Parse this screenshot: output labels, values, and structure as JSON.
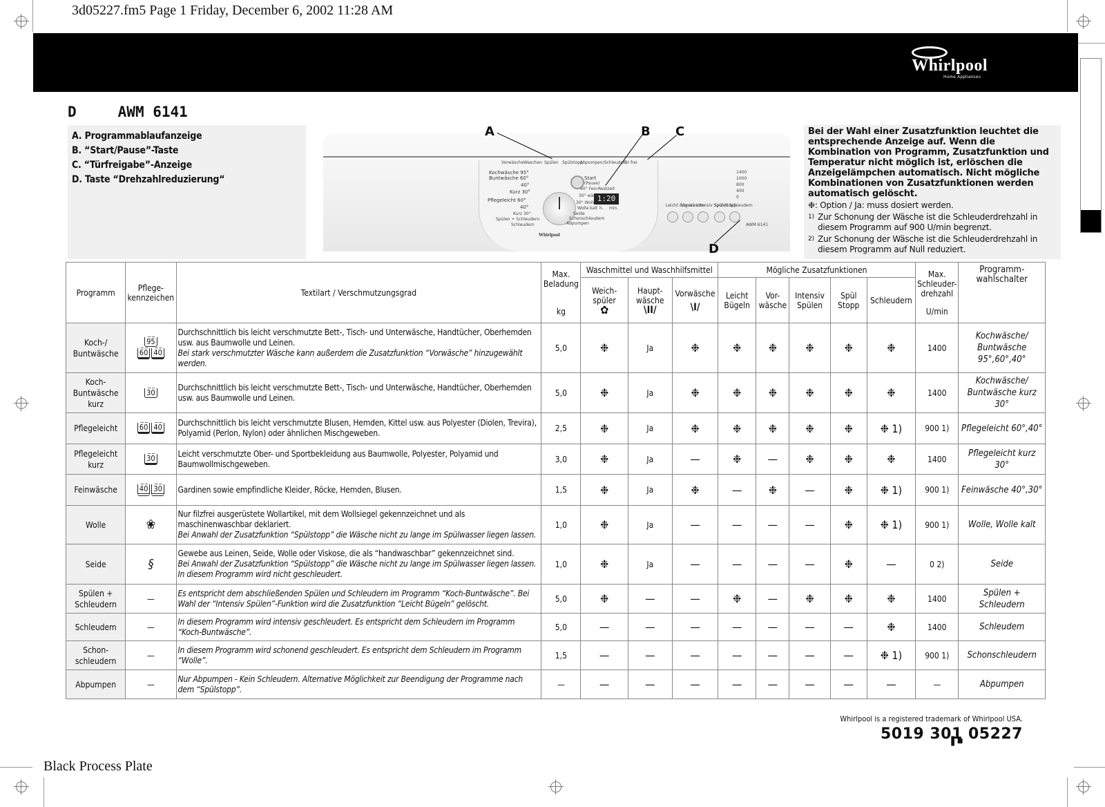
{
  "print": {
    "job_header": "3d05227.fm5  Page 1  Friday, December 6, 2002  11:28 AM",
    "plate_label": "Black Process Plate"
  },
  "brand": {
    "name": "Whirlpool",
    "subline": "Home Appliances"
  },
  "model": {
    "language": "D",
    "code": "AWM 6141"
  },
  "legend": [
    "A. Programmablaufanzeige",
    "B. “Start/Pause”-Taste",
    "C. “Türfreigabe”-Anzeige",
    "D. Taste “Drehzahlreduzierung“"
  ],
  "panel": {
    "labels": [
      "A",
      "B",
      "C",
      "D"
    ],
    "phase_lights": [
      "Vorwäsche",
      "Waschen",
      "Spülen",
      "Spülstopp",
      "Abpumpen/Schleudern",
      "Tür frei"
    ],
    "start_label": "Start",
    "start_sub": "(Pause)",
    "restzeit_label": "Restzeit",
    "display_value": "1:20",
    "display_units": [
      "h.",
      "min."
    ],
    "dial_left": [
      "Kochwäsche 95°",
      "Buntwäsche 60°",
      "40°",
      "Kurz 30°",
      "Pflegeleicht 60°",
      "40°",
      "Kurz 30°",
      "Spülen + Schleudern",
      "Schleudern"
    ],
    "dial_right": [
      "40° Fein-",
      "30° wäsche",
      "30° Wolle",
      "Wolle kalt",
      "Seide",
      "Schonschleudern",
      "Abpumpen"
    ],
    "speeds": [
      "1400",
      "1000",
      "800",
      "400",
      "0"
    ],
    "option_buttons": [
      "Leicht Bügeln",
      "Vor wäsche",
      "Intensiv Spülen",
      "Spül Stopp",
      "Schleudern"
    ],
    "model_mark": "AWM 6141",
    "brand_mark": "Whirlpool"
  },
  "notes": {
    "bold_text": "Bei der Wahl einer Zusatzfunktion leuchtet die entsprechende Anzeige auf. Wenn die Kombination von Programm, Zusatzfunktion und Temperatur nicht möglich ist, erlöschen die Anzeigelämpchen automatisch. Nicht mögliche Kombinationen von Zusatzfunktionen werden automatisch gelöscht.",
    "option_note": "❉: Option / Ja: muss dosiert werden.",
    "footnotes": [
      {
        "mark": "1)",
        "text": "Zur Schonung der Wäsche ist die Schleuderdrehzahl in diesem Programm auf 900 U/min begrenzt."
      },
      {
        "mark": "2)",
        "text": "Zur Schonung der Wäsche ist die Schleuderdrehzahl in diesem Programm auf Null reduziert."
      }
    ]
  },
  "table": {
    "headers": {
      "programm": "Programm",
      "pflege": "Pflege-kennzeichen",
      "textil": "Textilart / Verschmutzungsgrad",
      "beladung": "Max. Beladung",
      "beladung_unit": "kg",
      "waschmittel_group": "Waschmittel und Waschhilfsmittel",
      "weichspueler": "Weich-spüler",
      "hauptwaesche": "Haupt-wäsche",
      "vorwaesche": "Vorwäsche",
      "zusatz_group": "Mögliche Zusatzfunktionen",
      "leicht_buegeln": "Leicht Bügeln",
      "vor_waesche": "Vor-wäsche",
      "intensiv_spuelen": "Intensiv Spülen",
      "spuel_stopp": "Spül Stopp",
      "schleudern": "Schleudern",
      "drehzahl": "Max. Schleuder-drehzahl",
      "drehzahl_unit": "U/min",
      "wahlschalter": "Programm-wahlschalter"
    },
    "rows": [
      {
        "programm": "Koch-/ Buntwäsche",
        "care": [
          "95",
          "60",
          "40"
        ],
        "desc": "Durchschnittlich bis leicht verschmutzte Bett-, Tisch- und Unterwäsche, Handtücher, Oberhemden usw. aus Baumwolle und Leinen.",
        "desc_italic": "Bei stark verschmutzter Wäsche kann außerdem die Zusatzfunktion “Vorwäsche” hinzugewählt werden.",
        "kg": "5,0",
        "cells": [
          "❉",
          "Ja",
          "❉",
          "❉",
          "❉",
          "❉",
          "❉",
          "❉"
        ],
        "rpm": "1400",
        "wahl": "Kochwäsche/ Buntwäsche 95°,60°,40°"
      },
      {
        "programm": "Koch-Buntwäsche kurz",
        "care": [
          "30"
        ],
        "desc": "Durchschnittlich bis leicht verschmutzte Bett-, Tisch- und Unterwäsche, Handtücher, Oberhemden usw. aus Baumwolle und Leinen.",
        "desc_italic": "",
        "kg": "5,0",
        "cells": [
          "❉",
          "Ja",
          "❉",
          "❉",
          "❉",
          "❉",
          "❉",
          "❉"
        ],
        "rpm": "1400",
        "wahl": "Kochwäsche/ Buntwäsche kurz 30°"
      },
      {
        "programm": "Pflegeleicht",
        "care": [
          "60",
          "40"
        ],
        "desc": "Durchschnittlich bis leicht verschmutzte Blusen, Hemden, Kittel usw. aus Polyester (Diolen, Trevira), Polyamid (Perlon, Nylon) oder ähnlichen Mischgeweben.",
        "desc_italic": "",
        "kg": "2,5",
        "cells": [
          "❉",
          "Ja",
          "❉",
          "❉",
          "❉",
          "❉",
          "❉",
          "❉ 1)"
        ],
        "rpm": "900 1)",
        "wahl": "Pflegeleicht 60°,40°"
      },
      {
        "programm": "Pflegeleicht kurz",
        "care": [
          "30"
        ],
        "desc": "Leicht verschmutzte Ober- und Sportbekleidung aus Baumwolle, Polyester, Polyamid und Baumwollmischgeweben.",
        "desc_italic": "",
        "kg": "3,0",
        "cells": [
          "❉",
          "Ja",
          "—",
          "❉",
          "—",
          "❉",
          "❉",
          "❉"
        ],
        "rpm": "1400",
        "wahl": "Pflegeleicht kurz 30°"
      },
      {
        "programm": "Feinwäsche",
        "care": [
          "40",
          "30"
        ],
        "desc": "Gardinen sowie empfindliche Kleider, Röcke, Hemden, Blusen.",
        "desc_italic": "",
        "kg": "1,5",
        "cells": [
          "❉",
          "Ja",
          "❉",
          "—",
          "❉",
          "—",
          "❉",
          "❉ 1)"
        ],
        "rpm": "900 1)",
        "wahl": "Feinwäsche 40°,30°"
      },
      {
        "programm": "Wolle",
        "care": [
          "wool"
        ],
        "desc": "Nur filzfrei ausgerüstete Wollartikel, mit dem Wollsiegel gekennzeichnet und als maschinenwaschbar deklariert.",
        "desc_italic": "Bei Anwahl der Zusatzfunktion “Spülstopp” die Wäsche nicht zu lange im Spülwasser liegen lassen.",
        "kg": "1,0",
        "cells": [
          "❉",
          "Ja",
          "—",
          "—",
          "—",
          "—",
          "❉",
          "❉ 1)"
        ],
        "rpm": "900 1)",
        "wahl": "Wolle, Wolle kalt"
      },
      {
        "programm": "Seide",
        "care": [
          "silk"
        ],
        "desc": "Gewebe aus Leinen, Seide, Wolle oder Viskose, die als “handwaschbar” gekennzeichnet sind.",
        "desc_italic": "Bei Anwahl der Zusatzfunktion “Spülstopp” die Wäsche nicht zu lange im Spülwasser liegen lassen. In diesem Programm wird nicht geschleudert.",
        "kg": "1,0",
        "cells": [
          "❉",
          "Ja",
          "—",
          "—",
          "—",
          "—",
          "❉",
          "—"
        ],
        "rpm": "0 2)",
        "wahl": "Seide"
      },
      {
        "programm": "Spülen + Schleudern",
        "care": [],
        "desc": "",
        "desc_italic": "Es entspricht dem abschließenden Spülen und Schleudern im Programm “Koch-Buntwäsche”. Bei Wahl der “Intensiv Spülen”-Funktion wird die Zusatzfunktion “Leicht Bügeln” gelöscht.",
        "kg": "5,0",
        "cells": [
          "❉",
          "—",
          "—",
          "❉",
          "—",
          "❉",
          "❉",
          "❉"
        ],
        "rpm": "1400",
        "wahl": "Spülen + Schleudern"
      },
      {
        "programm": "Schleudem",
        "care": [],
        "desc": "",
        "desc_italic": "In diesem Programm wird intensiv geschleudert. Es entspricht dem Schleudern im Programm “Koch-Buntwäsche”.",
        "kg": "5,0",
        "cells": [
          "—",
          "—",
          "—",
          "—",
          "—",
          "—",
          "—",
          "❉"
        ],
        "rpm": "1400",
        "wahl": "Schleudem"
      },
      {
        "programm": "Schon-schleudern",
        "care": [],
        "desc": "",
        "desc_italic": "In diesem Programm wird schonend geschleudert. Es entspricht dem Schleudern im Programm “Wolle”.",
        "kg": "1,5",
        "cells": [
          "—",
          "—",
          "—",
          "—",
          "—",
          "—",
          "—",
          "❉ 1)"
        ],
        "rpm": "900 1)",
        "wahl": "Schonschleudern"
      },
      {
        "programm": "Abpumpen",
        "care": [],
        "desc": "",
        "desc_italic": "Nur Abpumpen - Kein Schleudern. Alternative Möglichkeit zur Beendigung der Programme nach dem “Spülstopp”.",
        "kg": "—",
        "cells": [
          "—",
          "—",
          "—",
          "—",
          "—",
          "—",
          "—",
          "—"
        ],
        "rpm": "—",
        "wahl": "Abpumpen"
      }
    ]
  },
  "footer": {
    "trademark": "Whirlpool is a registered trademark of Whirlpool USA.",
    "part_number": "5019 301 05227"
  }
}
